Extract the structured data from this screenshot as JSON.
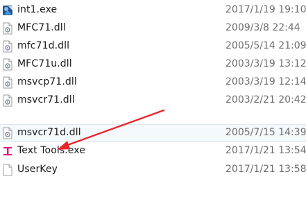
{
  "files": [
    {
      "name": "int1.exe",
      "date": "2017/1/19 19:10",
      "icon": "app-exe-icon"
    },
    {
      "name": "MFC71.dll",
      "date": "2009/3/8 22:44",
      "icon": "dll-file-icon"
    },
    {
      "name": "mfc71d.dll",
      "date": "2005/5/14 21:09",
      "icon": "dll-file-icon"
    },
    {
      "name": "MFC71u.dll",
      "date": "2003/3/19 13:12",
      "icon": "dll-file-icon"
    },
    {
      "name": "msvcp71.dll",
      "date": "2003/3/19 12:14",
      "icon": "dll-file-icon"
    },
    {
      "name": "msvcr71.dll",
      "date": "2003/2/21 20:42",
      "icon": "dll-file-icon"
    },
    {
      "name": "msvcr71d.dll",
      "date": "2005/7/15 14:39",
      "icon": "dll-file-icon"
    },
    {
      "name": "Text Tools.exe",
      "date": "2017/1/21 13:54",
      "icon": "text-tools-icon"
    },
    {
      "name": "UserKey",
      "date": "2017/1/21 13:58",
      "icon": "blank-file-icon"
    }
  ],
  "selected_index": 6,
  "colors": {
    "arrow": "#e8262a",
    "selection_bg": "#f4f9fe",
    "text_tools_icon": "#e6007e"
  }
}
